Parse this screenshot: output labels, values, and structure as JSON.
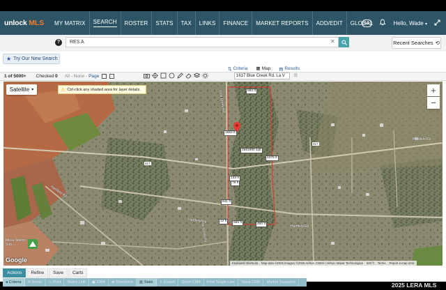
{
  "brand": {
    "name_prefix": "unlock ",
    "name_suffix": "MLS"
  },
  "nav": {
    "items": [
      {
        "label": "MY MATRIX"
      },
      {
        "label": "SEARCH"
      },
      {
        "label": "ROSTER"
      },
      {
        "label": "STATS"
      },
      {
        "label": "TAX"
      },
      {
        "label": "LINKS"
      },
      {
        "label": "FINANCE"
      },
      {
        "label": "MARKET REPORTS"
      },
      {
        "label": "ADD/EDIT"
      },
      {
        "label": "GLOBAL"
      }
    ],
    "active_index": 1
  },
  "header": {
    "text_size_label": "Aa",
    "user_greeting": "Hello, Wade"
  },
  "search": {
    "value": "RES A",
    "help": "?",
    "recent_label": "Recent Searches"
  },
  "banner": {
    "try_new_label": "Try Our New Search"
  },
  "view_tabs": [
    {
      "label": "Criteria"
    },
    {
      "label": "Map"
    },
    {
      "label": "Results"
    }
  ],
  "results": {
    "count_prefix": "1 of ",
    "count_total": "5000+",
    "checked_label": "Checked",
    "checked_value": "0",
    "all_label": "All",
    "none_label": "None",
    "page_label": "Page"
  },
  "map": {
    "address": "1617 Blue Creek Rd, La V",
    "type_label": "Satellite",
    "ctrl_hint": "Ctrl-click any shaded area for layer details.",
    "zoom_in": "+",
    "zoom_out": "−",
    "google": "Google",
    "attribution": {
      "shortcuts": "Keyboard shortcuts",
      "data": "Map data ©2026 Imagery ©2026 Airbus, CNES / Airbus, Maxar Technologies",
      "scale": "500 ft",
      "terms": "Terms",
      "report": "Report a map error"
    },
    "roads": {
      "blue_creek": "Blue Creek Rd",
      "hartfield_right": "Hartfield Rd",
      "hartfield_left": "Hartfield Rd",
      "hartfield_bottom": "Hartfield Rd",
      "hartfield_center": "Hartfield Rd",
      "blue_creek_lower": "Blue Creek Rd",
      "route_a": "417",
      "route_b": "417"
    },
    "measurements": {
      "top": "682 ft",
      "west_upper": "1663 ft",
      "area": "2661890 sqft",
      "east": "2379 ft",
      "mid1": "133 ft",
      "mid2": "78 ft",
      "mid3": "841 ft",
      "bottom1": "12 ft",
      "bottom2": "665 ft",
      "bottom3": "460 ft"
    },
    "poi": "Mesa Station Sub..."
  },
  "bottom_tabs": [
    {
      "label": "Actions"
    },
    {
      "label": "Refine"
    },
    {
      "label": "Save"
    },
    {
      "label": "Carts"
    }
  ],
  "actions": [
    {
      "label": "Criteria"
    },
    {
      "label": "Email"
    },
    {
      "label": "Print"
    },
    {
      "label": "Share Link"
    },
    {
      "label": "CMA"
    },
    {
      "label": "Directions"
    },
    {
      "label": "Stats"
    },
    {
      "label": "Export"
    },
    {
      "label": "Quick CMA"
    },
    {
      "label": "Print Single Line"
    },
    {
      "label": "Stack CMA"
    },
    {
      "label": "Market Snapshot"
    }
  ],
  "watermark": "2025 LERA MLS",
  "colors": {
    "topbar": "#2e5566",
    "accent": "#f47b2a",
    "button_teal": "#4aa3a8",
    "actions_teal": "#3c8fa3",
    "parcel_outline": "#e0302a",
    "marker": "#e53935"
  }
}
